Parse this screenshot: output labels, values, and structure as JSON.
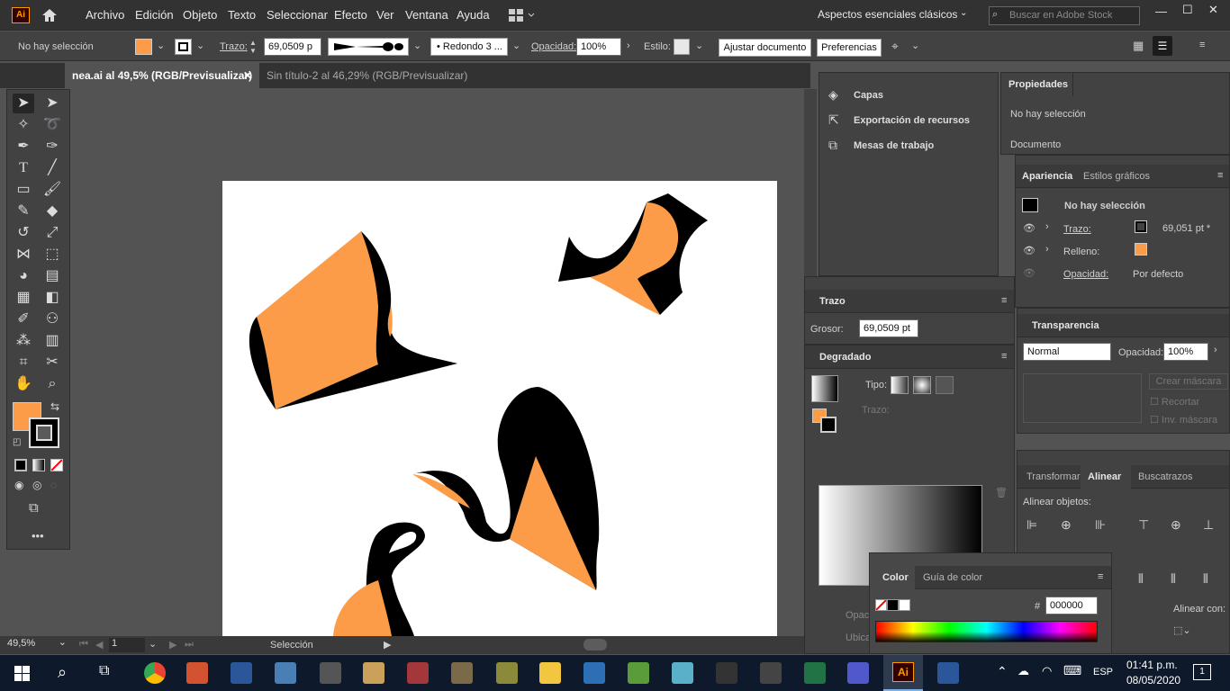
{
  "app": {
    "logo": "Ai",
    "workspace": "Aspectos esenciales clásicos",
    "stock_search": "Buscar en Adobe Stock"
  },
  "menu": [
    "Archivo",
    "Edición",
    "Objeto",
    "Texto",
    "Seleccionar",
    "Efecto",
    "Ver",
    "Ventana",
    "Ayuda"
  ],
  "control": {
    "selection": "No hay selección",
    "stroke_label": "Trazo:",
    "stroke_value": "69,0509 p",
    "brush": "Redondo 3 ...",
    "opacity_label": "Opacidad:",
    "opacity_value": "100%",
    "style_label": "Estilo:",
    "adjust_btn": "Ajustar documento",
    "prefs_btn": "Preferencias"
  },
  "tabs": [
    {
      "label": "nea.ai al 49,5% (RGB/Previsualizar)",
      "active": true
    },
    {
      "label": "Sin título-2 al 46,29% (RGB/Previsualizar)",
      "active": false
    }
  ],
  "status": {
    "zoom": "49,5%",
    "page": "1",
    "tool": "Selección"
  },
  "panels": {
    "docked": [
      "Capas",
      "Exportación de recursos",
      "Mesas de trabajo"
    ],
    "properties": {
      "title": "Propiedades",
      "none": "No hay selección",
      "document": "Documento"
    },
    "appearance": {
      "tab1": "Apariencia",
      "tab2": "Estilos gráficos",
      "none": "No hay selección",
      "stroke": "Trazo:",
      "stroke_val": "69,051 pt *",
      "fill": "Relleno:",
      "opacity": "Opacidad:",
      "opacity_val": "Por defecto"
    },
    "stroke": {
      "title": "Trazo",
      "weight_label": "Grosor:",
      "weight": "69,0509 pt"
    },
    "gradient": {
      "title": "Degradado",
      "type": "Tipo:",
      "stroke": "Trazo:",
      "opac": "Opac",
      "ubic": "Ubica"
    },
    "transparency": {
      "title": "Transparencia",
      "mode": "Normal",
      "opacity_label": "Opacidad:",
      "opacity": "100%",
      "mask": "Crear máscara",
      "clip": "Recortar",
      "invert": "Inv. máscara"
    },
    "align": {
      "tab1": "Transformar",
      "tab2": "Alinear",
      "tab3": "Buscatrazos",
      "objects": "Alinear objetos:",
      "align_to": "Alinear con:"
    },
    "color": {
      "tab1": "Color",
      "tab2": "Guía de color",
      "hex_label": "#",
      "hex": "000000"
    }
  },
  "taskbar": {
    "lang": "ESP",
    "time": "01:41 p.m.",
    "date": "08/05/2020",
    "notif": "1"
  },
  "colors": {
    "accent_fill": "#fd9c48",
    "stroke": "#000000"
  }
}
